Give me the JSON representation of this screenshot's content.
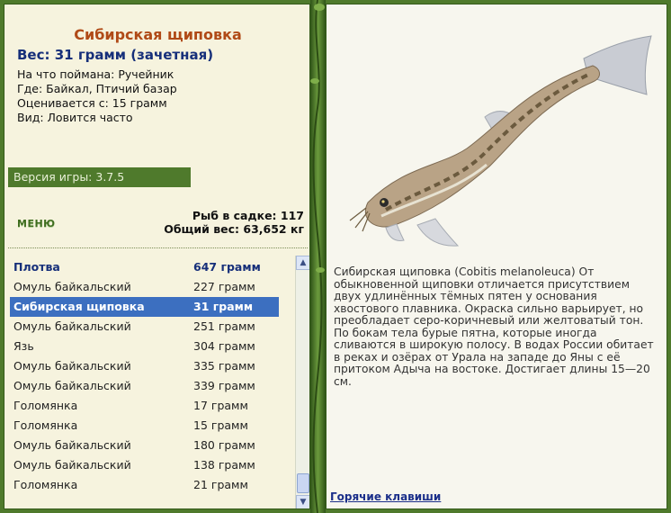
{
  "fish": {
    "title": "Сибирская щиповка",
    "weight_line": "Вес: 31 грамм (зачетная)",
    "details": [
      "На что поймана: Ручейник",
      "Где: Байкал, Птичий базар",
      "Оценивается с: 15 грамм",
      "Вид: Ловится часто"
    ]
  },
  "version_label": "Версия игры: 3.7.5",
  "menu_label": "МЕНЮ",
  "stats": {
    "fish_count": "Рыб в садке: 117",
    "total_weight": "Общий вес: 63,652 кг"
  },
  "catch_list": {
    "header": {
      "name": "Плотва",
      "weight": "647 грамм"
    },
    "rows": [
      {
        "name": "Омуль байкальский",
        "weight": "227 грамм"
      },
      {
        "name": "Сибирская щиповка",
        "weight": "31 грамм",
        "selected": true
      },
      {
        "name": "Омуль байкальский",
        "weight": "251 грамм"
      },
      {
        "name": "Язь",
        "weight": "304 грамм"
      },
      {
        "name": "Омуль байкальский",
        "weight": "335 грамм"
      },
      {
        "name": "Омуль байкальский",
        "weight": "339 грамм"
      },
      {
        "name": "Голомянка",
        "weight": "17 грамм"
      },
      {
        "name": "Голомянка",
        "weight": "15 грамм"
      },
      {
        "name": "Омуль байкальский",
        "weight": "180 грамм"
      },
      {
        "name": "Омуль байкальский",
        "weight": "138 грамм"
      },
      {
        "name": "Голомянка",
        "weight": "21 грамм"
      }
    ]
  },
  "description": "Сибирская щиповка (Cobitis melanoleuca) От обыкновенной щиповки отличается присутствием двух удлинённых тёмных пятен у основания хвостового плавника. Окраска сильно варьирует, но преобладает серо-коричневый или желтоватый тон. По бокам тела бурые пятна, которые иногда сливаются в широкую полосу. В водах России обитает в реках и озёрах от Урала на западе до Яны с её притоком Адыча на востоке. Достигает длины 15—20 см.",
  "hotkeys_label": "Горячие клавиши",
  "icons": {
    "scroll_up": "chevron-up-icon",
    "scroll_down": "chevron-down-icon"
  },
  "colors": {
    "frame_green": "#4f7a2c",
    "title_orange": "#b04a17",
    "header_blue": "#162f7a",
    "selection_blue": "#3c6fc0"
  }
}
